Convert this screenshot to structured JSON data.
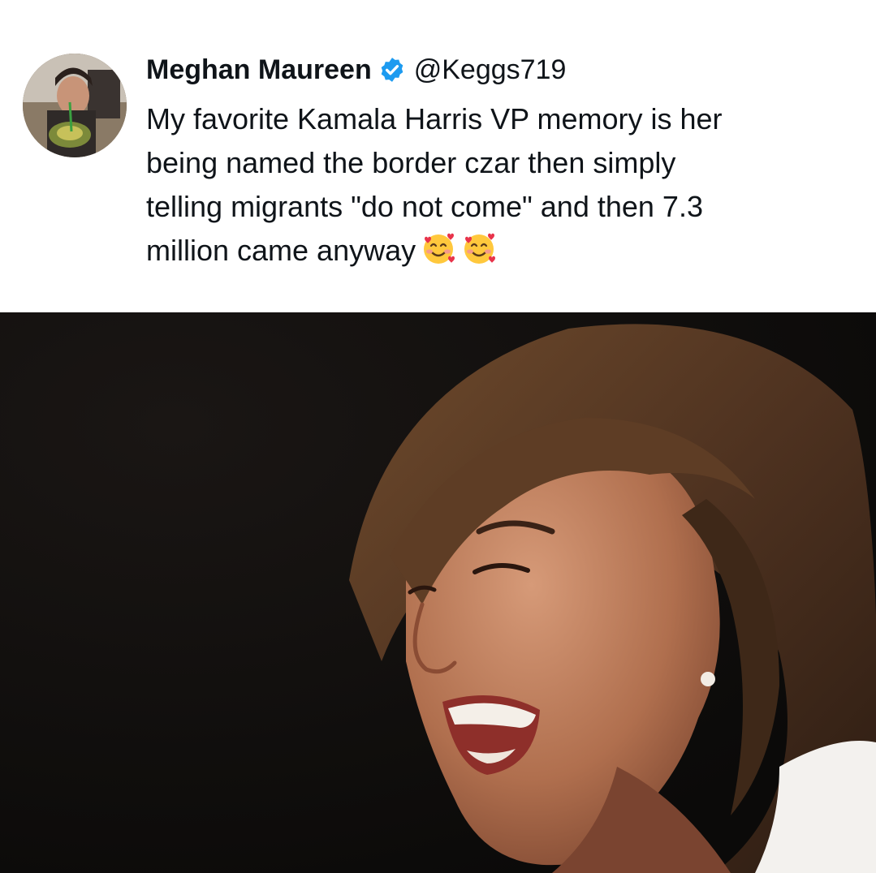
{
  "post": {
    "display_name": "Meghan Maureen",
    "handle": "@Keggs719",
    "verified": true,
    "text": "My favorite Kamala Harris VP memory is her\nbeing named the border czar then simply\ntelling migrants \"do not come\" and then 7.3\nmillion came anyway",
    "emoji_name": "smiling-face-with-hearts",
    "emoji_count": 2
  },
  "colors": {
    "text": "#0f1419",
    "verified_badge": "#1d9bf0",
    "photo_background": "#0e0c0b"
  }
}
